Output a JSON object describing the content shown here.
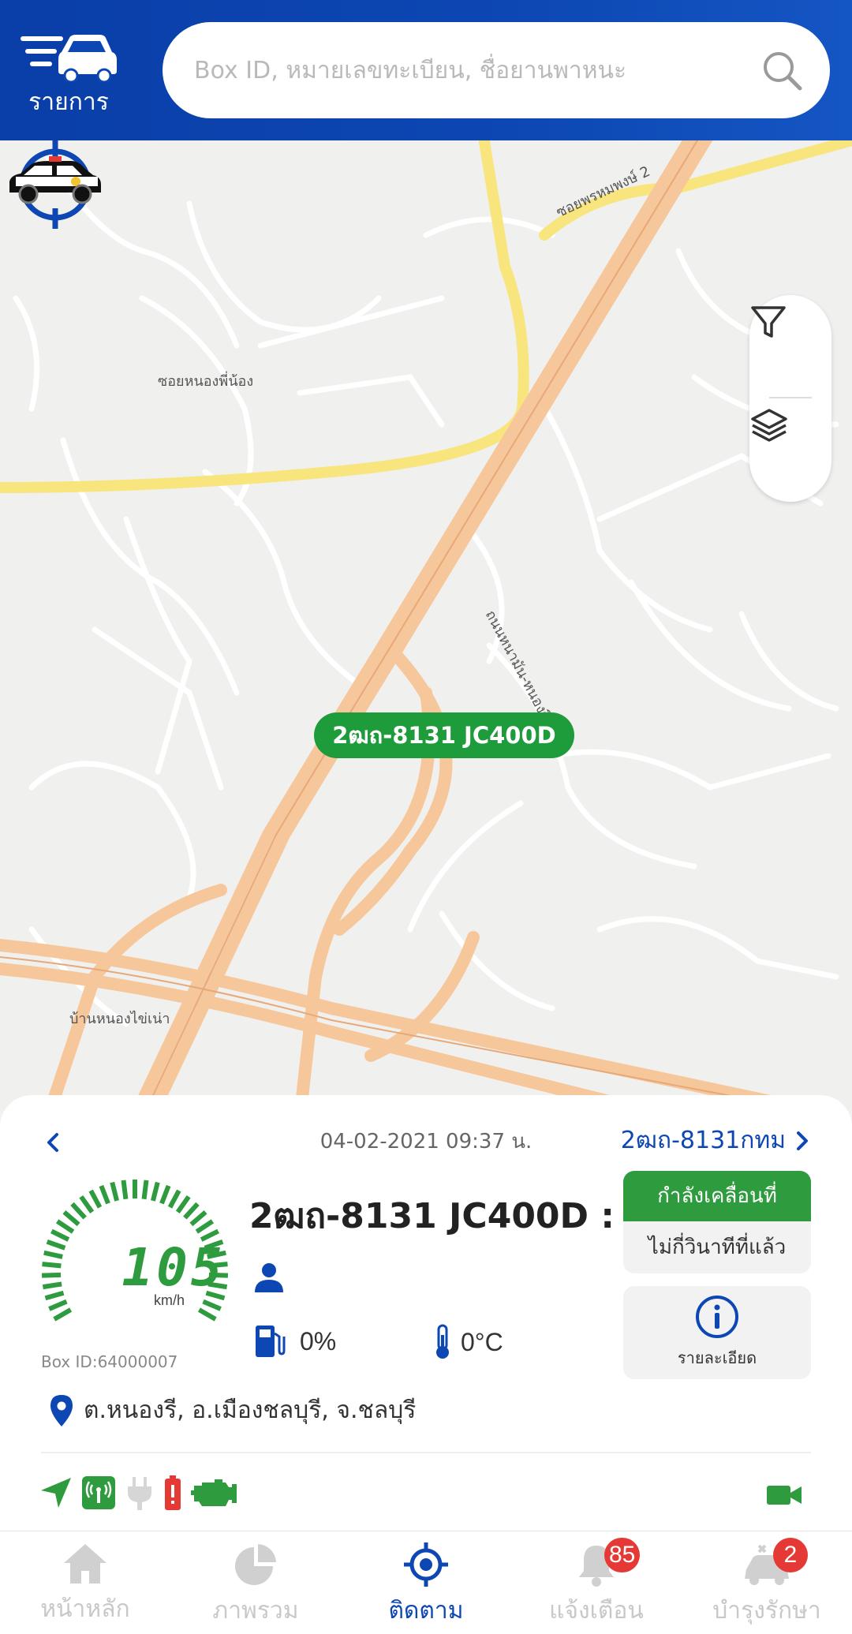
{
  "header": {
    "menu_label": "รายการ",
    "search_placeholder": "Box ID, หมายเลขทะเบียน, ชื่อยานพาหนะ"
  },
  "map": {
    "vehicle_label": "2ฒถ-8131 JC400D",
    "place_labels": {
      "road_1": "ซอยหนองพี่น้อง",
      "road_2": "ซอยพรหมพงษ์ 2",
      "road_3": "ถนนหนามัน-หนองรี",
      "village": "บ้านหนองไข่เน่า"
    },
    "colors": {
      "major_road": "#f6c79a",
      "secondary_road": "#f8e57e",
      "background": "#f0f0ef",
      "minor_road": "#ffffff"
    }
  },
  "panel": {
    "timestamp": "04-02-2021 09:37 น.",
    "plate_nav": "2ฒถ-8131กทม",
    "speed": "105",
    "speed_unit": "km/h",
    "box_id": "Box ID:64000007",
    "vehicle_title": "2ฒถ-8131 JC400D : ...",
    "fuel": "0%",
    "temperature": "0°C",
    "status_moving": "กำลังเคลื่อนที่",
    "status_time": "ไม่กี่วินาทีที่แล้ว",
    "detail_label": "รายละเอียด",
    "location": "ต.หนองรี, อ.เมืองชลบุรี, จ.ชลบุรี"
  },
  "nav": {
    "items": [
      {
        "label": "หน้าหลัก",
        "icon": "home-icon"
      },
      {
        "label": "ภาพรวม",
        "icon": "pie-chart-icon"
      },
      {
        "label": "ติดตาม",
        "icon": "target-icon"
      },
      {
        "label": "แจ้งเตือน",
        "icon": "bell-icon",
        "badge": "85"
      },
      {
        "label": "บำรุงรักษา",
        "icon": "car-maintenance-icon",
        "badge": "2"
      }
    ]
  },
  "colors": {
    "brand_blue": "#0d47b3",
    "moving_green": "#2e9b3e",
    "badge_red": "#e53935",
    "alert_red": "#e53935"
  }
}
